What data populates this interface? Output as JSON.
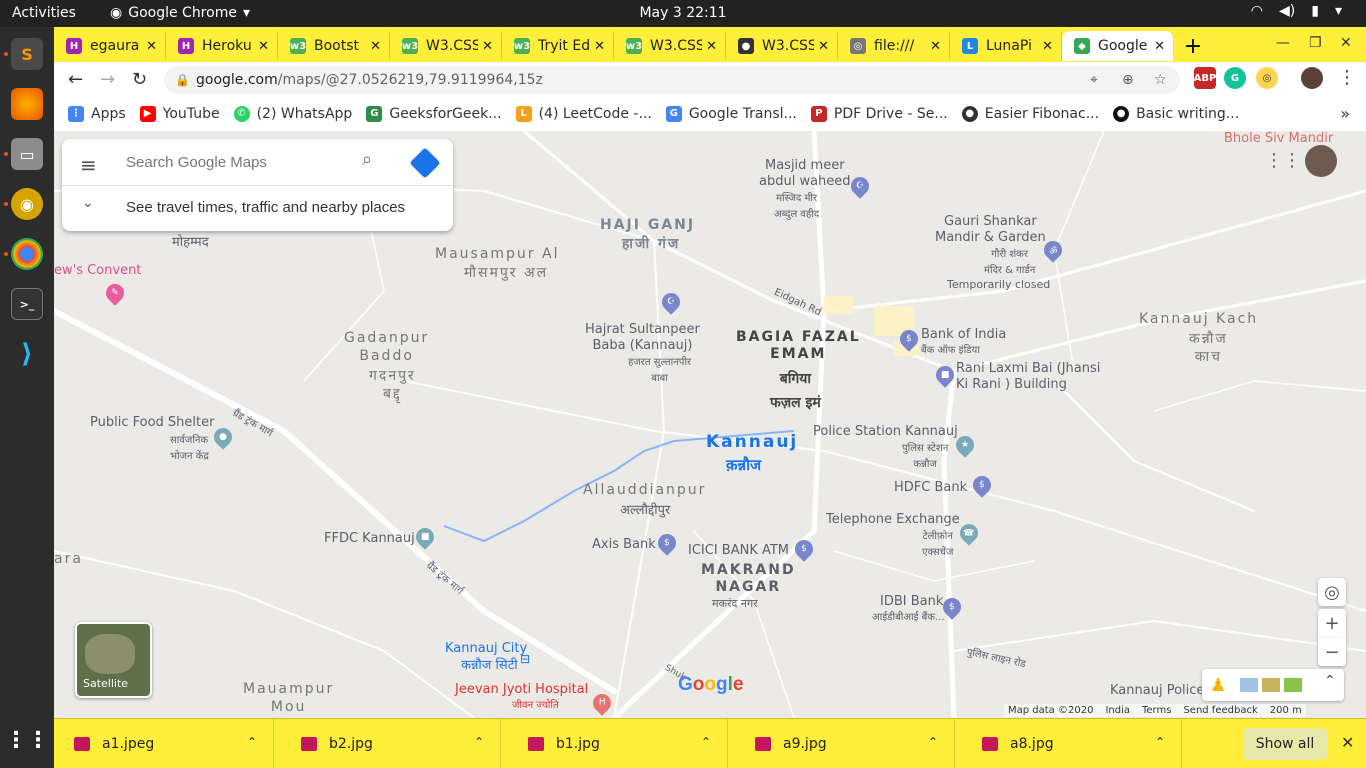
{
  "topbar": {
    "activities": "Activities",
    "app_name": "Google Chrome",
    "clock": "May 3  22:11"
  },
  "tabs": [
    {
      "title": "egaura",
      "color": "#9c27b0",
      "glyph": "H"
    },
    {
      "title": "Heroku",
      "color": "#9c27b0",
      "glyph": "H"
    },
    {
      "title": "Bootst",
      "color": "#4caf50",
      "glyph": "w3"
    },
    {
      "title": "W3.CSS",
      "color": "#4caf50",
      "glyph": "w3"
    },
    {
      "title": "Tryit Ed",
      "color": "#4caf50",
      "glyph": "w3"
    },
    {
      "title": "W3.CSS",
      "color": "#4caf50",
      "glyph": "w3"
    },
    {
      "title": "W3.CSS",
      "color": "#333333",
      "glyph": "●"
    },
    {
      "title": "file:///",
      "color": "#777777",
      "glyph": "◎"
    },
    {
      "title": "LunaPi",
      "color": "#1e88e5",
      "glyph": "L"
    },
    {
      "title": "Google",
      "color": "#34a853",
      "glyph": "◆"
    }
  ],
  "addressbar": {
    "host": "google.com",
    "path": "/maps/@27.0526219,79.9119964,15z"
  },
  "bookmarks": [
    {
      "label": "Apps",
      "color": "#4285f4",
      "glyph": "⋮"
    },
    {
      "label": "YouTube",
      "color": "#ff0000",
      "glyph": "▶"
    },
    {
      "label": "(2) WhatsApp",
      "color": "#25d366",
      "glyph": "✆"
    },
    {
      "label": "GeeksforGeek...",
      "color": "#2f8d46",
      "glyph": "G"
    },
    {
      "label": "(4) LeetCode -...",
      "color": "#f89f1b",
      "glyph": "L"
    },
    {
      "label": "Google Transl...",
      "color": "#4285f4",
      "glyph": "G"
    },
    {
      "label": "PDF Drive - Se...",
      "color": "#c62828",
      "glyph": "P"
    },
    {
      "label": "Easier Fibonac...",
      "color": "#333333",
      "glyph": "●"
    },
    {
      "label": "Basic writing...",
      "color": "#111111",
      "glyph": "●"
    }
  ],
  "search": {
    "placeholder": "Search Google Maps",
    "travel": "See travel times, traffic and nearby places"
  },
  "map_labels": {
    "haji_ganj": "HAJI GANJ",
    "haji_ganj_hi": "हाजी गंज",
    "masjid": "Masjid meer\nabdul waheed",
    "masjid_hi": "मस्जिद मीर\nअब्दुल वहीद",
    "gauri": "Gauri Shankar\nMandir & Garden",
    "gauri_hi": "गौरी शंकर\nमंदिर & गार्डन",
    "gauri_closed": "Temporarily closed",
    "bhole": "Bhole Siv Mandir",
    "mausampur": "Mausampur Al",
    "mausampur_hi": "मौसमपुर अल",
    "mohammad": "मोहम्मद",
    "convent": "ew's Convent",
    "hajrat": "Hajrat Sultanpeer\nBaba (Kannauj)",
    "hajrat_hi": "हजरत सुल्तानपीर\nबाबा",
    "bagia": "BAGIA FAZAL\nEMAM",
    "bagia_hi": "बगिया\nफज़ल इमं",
    "bank_india": "Bank of India",
    "bank_india_hi": "बैंक ऑफ इंडिया",
    "kannauj_kach": "Kannauj Kach",
    "kannauj_kach_hi": "कन्नौज\nकाच",
    "rani": "Rani Laxmi Bai (Jhansi\nKi Rani ) Building",
    "gadanpur": "Gadanpur\nBaddo",
    "gadanpur_hi": "गदनपुर\nबद्दृ",
    "public_food": "Public Food Shelter",
    "public_food_hi": "सार्वजनिक\nभोजन केंद्र",
    "grand_trunk": "ग्रैंड ट्रंक मार्ग",
    "kannauj": "Kannauj",
    "kannauj_hi": "क़न्नौज",
    "police": "Police Station Kannauj",
    "police_hi": "पुलिस स्टेशन\nकन्नौज",
    "hdfc": "HDFC Bank",
    "allauddi": "Allauddianpur",
    "allauddi_hi": "अल्लौद्दीपुर",
    "telephone": "Telephone Exchange",
    "telephone_hi": "टेलीफ़ोन\nएक्सचेंज",
    "ffdc": "FFDC Kannauj",
    "axis": "Axis Bank",
    "icici": "ICICI BANK ATM",
    "makrand": "MAKRAND\nNAGAR",
    "makrand_hi": "मकरंद नगर",
    "idbi": "IDBI Bank",
    "idbi_hi": "आईडीबीआई बैंक...",
    "ara": "ara",
    "kannauj_city": "Kannauj City",
    "kannauj_city_hi": "कन्नौज सिटी",
    "jeevan": "Jeevan Jyoti Hospital",
    "jeevan_hi": "जीवन ज्योति",
    "mauampur": "Mauampur\nMou",
    "kannauj_police": "Kannauj Police",
    "eidgah": "Eidgah Rd",
    "police_line": "पुलिस लाइन रोड",
    "shuk": "Shuk"
  },
  "satellite_label": "Satellite",
  "google_logo": "Google",
  "footer": {
    "map_data": "Map data ©2020",
    "country": "India",
    "terms": "Terms",
    "feedback": "Send feedback",
    "scale": "200 m"
  },
  "downloads": [
    {
      "name": "a1.jpeg"
    },
    {
      "name": "b2.jpg"
    },
    {
      "name": "b1.jpg"
    },
    {
      "name": "a9.jpg"
    },
    {
      "name": "a8.jpg"
    }
  ],
  "show_all": "Show all"
}
